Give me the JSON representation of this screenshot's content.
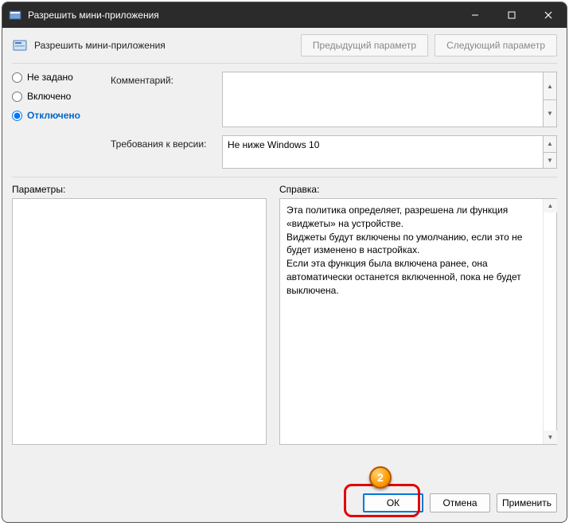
{
  "window": {
    "title": "Разрешить мини-приложения"
  },
  "header": {
    "policy_title": "Разрешить мини-приложения",
    "prev_btn": "Предыдущий параметр",
    "next_btn": "Следующий параметр"
  },
  "radios": {
    "not_configured": "Не задано",
    "enabled": "Включено",
    "disabled": "Отключено"
  },
  "fields": {
    "comment_label": "Комментарий:",
    "version_label": "Требования к версии:",
    "version_value": "Не ниже Windows 10"
  },
  "section_labels": {
    "options": "Параметры:",
    "help": "Справка:"
  },
  "help_text": "Эта политика определяет, разрешена ли функция «виджеты» на устройстве.\nВиджеты будут включены по умолчанию, если это не будет изменено в настройках.\nЕсли эта функция была включена ранее, она автоматически останется включенной, пока не будет выключена.",
  "footer": {
    "ok": "ОК",
    "cancel": "Отмена",
    "apply": "Применить"
  },
  "callout": {
    "number": "2"
  }
}
